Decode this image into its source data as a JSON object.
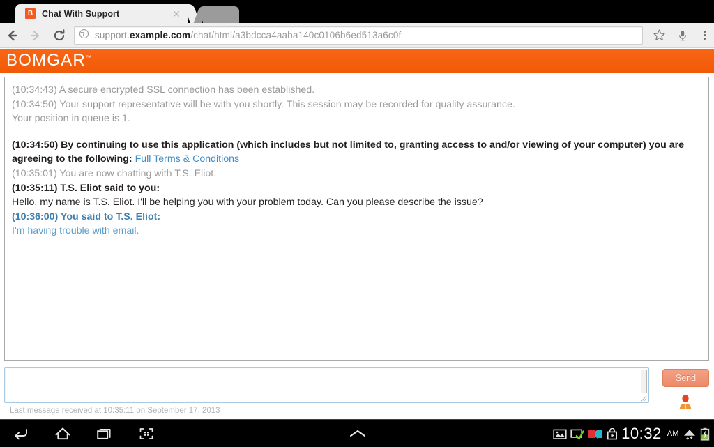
{
  "browser": {
    "tab": {
      "title": "Chat With Support",
      "favicon_letter": "B",
      "close_icon": "close-icon"
    },
    "new_tab_icon": "new-tab-icon",
    "back_icon": "back-arrow-icon",
    "forward_icon": "forward-arrow-icon",
    "reload_icon": "reload-icon",
    "site_icon": "globe-icon",
    "url": {
      "prefix": "support.",
      "domain": "example.com",
      "path": "/chat/html/a3bdcca4aaba140c0106b6ed513a6c0f",
      "full": "support.example.com/chat/html/a3bdcca4aaba140c0106b6ed513a6c0f"
    },
    "bookmark_icon": "star-icon",
    "voice_icon": "microphone-icon",
    "menu_icon": "overflow-menu-icon"
  },
  "brand": {
    "name": "BOMGAR",
    "trademark": "™",
    "color": "#f15a07"
  },
  "chat": {
    "messages": [
      {
        "id": "ssl",
        "kind": "system",
        "text": "(10:34:43) A secure encrypted SSL connection has been established."
      },
      {
        "id": "queue1",
        "kind": "system",
        "text": "(10:34:50) Your support representative will be with you shortly. This session may be recorded for quality assurance."
      },
      {
        "id": "queue2",
        "kind": "system",
        "text": "Your position in queue is 1."
      },
      {
        "id": "terms",
        "kind": "terms",
        "text": "(10:34:50) By continuing to use this application (which includes but not limited to, granting access to and/or viewing of your computer) you are agreeing to the following:",
        "link_label": "Full Terms & Conditions"
      },
      {
        "id": "joined",
        "kind": "system",
        "text": "(10:35:01) You are now chatting with T.S. Eliot."
      },
      {
        "id": "rep-h",
        "kind": "rep-head",
        "text": "(10:35:11) T.S. Eliot said to you:"
      },
      {
        "id": "rep-b",
        "kind": "rep-body",
        "text": "Hello, my name is T.S. Eliot. I'll be helping you with your problem today. Can you please describe the issue?"
      },
      {
        "id": "you-h",
        "kind": "you-head",
        "text": "(10:36:00) You said to T.S. Eliot:"
      },
      {
        "id": "you-b",
        "kind": "you-body",
        "text": "I'm having trouble with email."
      }
    ]
  },
  "composer": {
    "message_value": "",
    "message_placeholder": "",
    "send_label": "Send",
    "avatar_icon": "user-avatar-icon",
    "status": "Last message received at 10:35:11 on September 17, 2013"
  },
  "system_bar": {
    "back_icon": "android-back-icon",
    "home_icon": "android-home-icon",
    "recents_icon": "android-recents-icon",
    "screenshot_icon": "android-screenshot-icon",
    "expand_icon": "chevron-up-icon",
    "tray_icons": [
      "screenshot-capture-icon",
      "screen-check-icon",
      "video-chat-icon",
      "play-store-icon"
    ],
    "clock": "10:32",
    "meridiem": "AM",
    "wifi_icon": "wifi-icon",
    "battery_icon": "battery-charging-icon"
  }
}
